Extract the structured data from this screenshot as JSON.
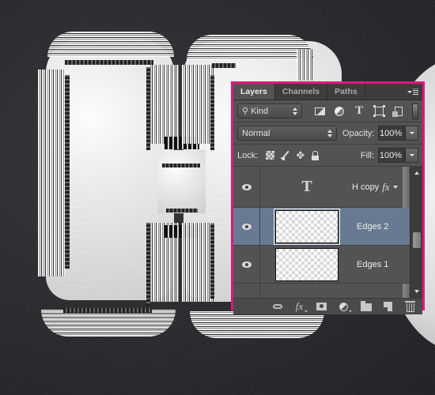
{
  "artwork": {
    "description": "Stitched embroidered letter H on dark denim background",
    "background_color": "#2c2b2f",
    "accent_border_color": "#e0187a"
  },
  "panel": {
    "tabs": [
      {
        "label": "Layers",
        "active": true
      },
      {
        "label": "Channels",
        "active": false
      },
      {
        "label": "Paths",
        "active": false
      }
    ],
    "menu_icon": "panel-menu-icon",
    "filter": {
      "kind_label": "Kind",
      "search_icon": "search-icon",
      "filter_icons": [
        "image-filter-icon",
        "adjustment-filter-icon",
        "type-filter-icon",
        "shape-filter-icon",
        "smart-object-filter-icon"
      ]
    },
    "blend_mode": "Normal",
    "opacity_label": "Opacity:",
    "opacity_value": "100%",
    "lock_label": "Lock:",
    "lock_icons": [
      "lock-transparent-icon",
      "lock-pixels-icon",
      "lock-position-icon",
      "lock-all-icon"
    ],
    "fill_label": "Fill:",
    "fill_value": "100%",
    "layers": [
      {
        "name": "H copy",
        "type": "text",
        "thumb_glyph": "T",
        "visible": true,
        "has_fx": true,
        "fx_label": "fx",
        "selected": false
      },
      {
        "name": "Edges 2",
        "type": "pixel",
        "visible": true,
        "has_fx": false,
        "selected": true
      },
      {
        "name": "Edges 1",
        "type": "pixel",
        "visible": true,
        "has_fx": false,
        "selected": false
      }
    ],
    "footer": {
      "buttons": [
        "link-layers",
        "add-layer-style",
        "add-mask",
        "new-fill-adjustment-layer",
        "new-group",
        "new-layer",
        "delete-layer"
      ],
      "fx_label": "fx"
    },
    "colors": {
      "panel_bg": "#535353",
      "selected_row": "#687a91",
      "tab_bar": "#3d3d3d"
    }
  }
}
